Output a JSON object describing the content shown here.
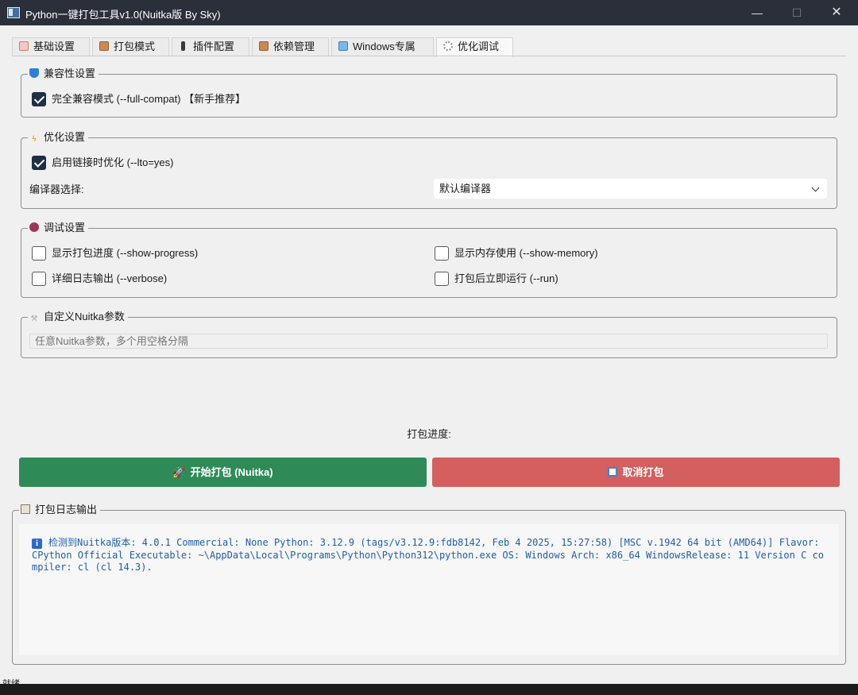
{
  "window": {
    "title": "Python一键打包工具v1.0(Nuitka版 By Sky)",
    "controls": {
      "minimize": "—",
      "maximize": "☐",
      "close": "✕"
    }
  },
  "tabs": [
    {
      "label": "基础设置",
      "icon": "pencil-note-icon",
      "active": false
    },
    {
      "label": "打包模式",
      "icon": "package-box-icon",
      "active": false
    },
    {
      "label": "插件配置",
      "icon": "plug-pin-icon",
      "active": false
    },
    {
      "label": "依赖管理",
      "icon": "package-box-icon",
      "active": false
    },
    {
      "label": "Windows专属",
      "icon": "windows-window-icon",
      "active": false
    },
    {
      "label": "优化调试",
      "icon": "gear-icon",
      "active": true
    }
  ],
  "compat": {
    "title": "兼容性设置",
    "icon": "shield-icon",
    "full_compat": {
      "label": "完全兼容模式 (--full-compat) 【新手推荐】",
      "checked": true
    }
  },
  "optimize": {
    "title": "优化设置",
    "icon": "lightning-icon",
    "lto": {
      "label": "启用链接时优化 (--lto=yes)",
      "checked": true
    },
    "compiler_label": "编译器选择:",
    "compiler_value": "默认编译器"
  },
  "debug": {
    "title": "调试设置",
    "icon": "bug-icon",
    "show_progress": {
      "label": "显示打包进度 (--show-progress)",
      "checked": false
    },
    "show_memory": {
      "label": "显示内存使用 (--show-memory)",
      "checked": false
    },
    "verbose": {
      "label": "详细日志输出 (--verbose)",
      "checked": false
    },
    "run": {
      "label": "打包后立即运行 (--run)",
      "checked": false
    }
  },
  "custom": {
    "title": "自定义Nuitka参数",
    "icon": "wrench-icon",
    "placeholder": "任意Nuitka参数，多个用空格分隔",
    "value": ""
  },
  "progress": {
    "label": "打包进度:"
  },
  "buttons": {
    "start": {
      "label": "开始打包 (Nuitka)",
      "icon": "rocket-icon",
      "color": "#2e8b57"
    },
    "cancel": {
      "label": "取消打包",
      "icon": "stop-icon",
      "color": "#d35f5f"
    }
  },
  "log": {
    "title": "打包日志输出",
    "icon": "clipboard-icon",
    "message_icon": "info-icon",
    "message": "检测到Nuitka版本: 4.0.1 Commercial: None Python: 3.12.9 (tags/v3.12.9:fdb8142, Feb 4 2025, 15:27:58) [MSC v.1942 64 bit (AMD64)] Flavor: CPython Official Executable: ~\\AppData\\Local\\Programs\\Python\\Python312\\python.exe OS: Windows Arch: x86_64 WindowsRelease: 11 Version C compiler: cl (cl 14.3)."
  },
  "status": {
    "text": "就绪"
  }
}
